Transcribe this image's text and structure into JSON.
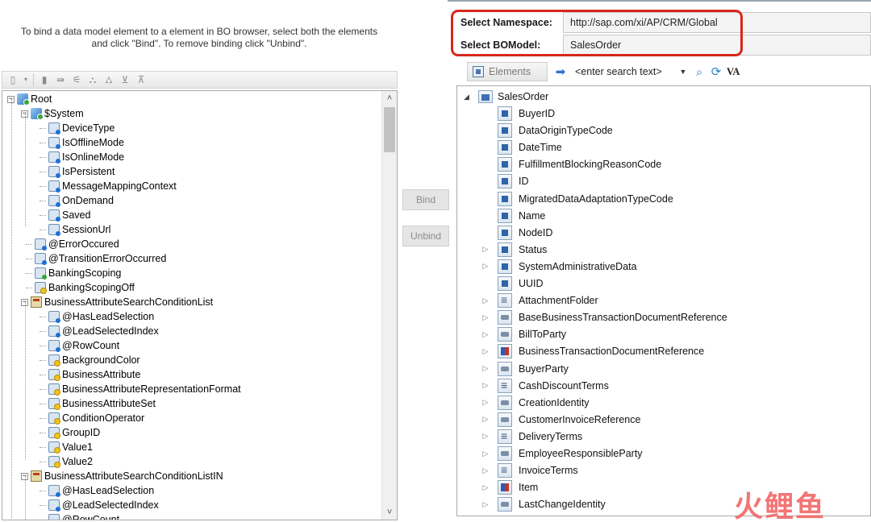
{
  "instructions": "To bind a data model element to a element in BO browser, select both the elements and click \"Bind\". To remove binding click \"Unbind\".",
  "left_toolbar": {
    "icons": [
      "new-document-icon",
      "delete-icon",
      "move-icon",
      "filter-icon",
      "expand-node-icon",
      "collapse-node-icon",
      "expand-all-icon",
      "collapse-all-icon"
    ]
  },
  "left_tree": {
    "items": [
      {
        "label": "Root",
        "level": 0,
        "icon": "root",
        "expander": "−"
      },
      {
        "label": "$System",
        "level": 1,
        "icon": "root",
        "expander": "−"
      },
      {
        "label": "DeviceType",
        "level": 2,
        "icon": "blue"
      },
      {
        "label": "IsOfflineMode",
        "level": 2,
        "icon": "blue"
      },
      {
        "label": "IsOnlineMode",
        "level": 2,
        "icon": "blue"
      },
      {
        "label": "IsPersistent",
        "level": 2,
        "icon": "blue"
      },
      {
        "label": "MessageMappingContext",
        "level": 2,
        "icon": "blue"
      },
      {
        "label": "OnDemand",
        "level": 2,
        "icon": "blue"
      },
      {
        "label": "Saved",
        "level": 2,
        "icon": "blue"
      },
      {
        "label": "SessionUrl",
        "level": 2,
        "icon": "blue"
      },
      {
        "label": "@ErrorOccured",
        "level": 1,
        "icon": "blue"
      },
      {
        "label": "@TransitionErrorOccurred",
        "level": 1,
        "icon": "blue"
      },
      {
        "label": "BankingScoping",
        "level": 1,
        "icon": "green"
      },
      {
        "label": "BankingScopingOff",
        "level": 1,
        "icon": "yellow"
      },
      {
        "label": "BusinessAttributeSearchConditionList",
        "level": 1,
        "icon": "folder",
        "expander": "−"
      },
      {
        "label": "@HasLeadSelection",
        "level": 2,
        "icon": "blue"
      },
      {
        "label": "@LeadSelectedIndex",
        "level": 2,
        "icon": "blue"
      },
      {
        "label": "@RowCount",
        "level": 2,
        "icon": "blue"
      },
      {
        "label": "BackgroundColor",
        "level": 2,
        "icon": "yellow"
      },
      {
        "label": "BusinessAttribute",
        "level": 2,
        "icon": "yellow"
      },
      {
        "label": "BusinessAttributeRepresentationFormat",
        "level": 2,
        "icon": "yellow"
      },
      {
        "label": "BusinessAttributeSet",
        "level": 2,
        "icon": "yellow"
      },
      {
        "label": "ConditionOperator",
        "level": 2,
        "icon": "yellow"
      },
      {
        "label": "GroupID",
        "level": 2,
        "icon": "yellow"
      },
      {
        "label": "Value1",
        "level": 2,
        "icon": "yellow"
      },
      {
        "label": "Value2",
        "level": 2,
        "icon": "yellow"
      },
      {
        "label": "BusinessAttributeSearchConditionListIN",
        "level": 1,
        "icon": "folder",
        "expander": "−"
      },
      {
        "label": "@HasLeadSelection",
        "level": 2,
        "icon": "blue"
      },
      {
        "label": "@LeadSelectedIndex",
        "level": 2,
        "icon": "blue"
      },
      {
        "label": "@RowCount",
        "level": 2,
        "icon": "blue"
      }
    ],
    "scroll_up": "˄",
    "scroll_down": "˅"
  },
  "buttons": {
    "bind": "Bind",
    "unbind": "Unbind"
  },
  "namespace": {
    "namespace_label": "Select Namespace:",
    "namespace_value": "http://sap.com/xi/AP/CRM/Global",
    "bomodel_label": "Select BOModel:",
    "bomodel_value": "SalesOrder",
    "highlight_color": "#d9261c"
  },
  "right_toolbar": {
    "elements_tab": "Elements",
    "search_placeholder": "<enter search text>",
    "va_label": "VA"
  },
  "right_tree": {
    "root": "SalesOrder",
    "root_expander": "◢",
    "items": [
      {
        "label": "BuyerID",
        "icon": "attr",
        "expandable": false
      },
      {
        "label": "DataOriginTypeCode",
        "icon": "attr",
        "expandable": false
      },
      {
        "label": "DateTime",
        "icon": "attr",
        "expandable": false
      },
      {
        "label": "FulfillmentBlockingReasonCode",
        "icon": "attr",
        "expandable": false
      },
      {
        "label": "ID",
        "icon": "attr",
        "expandable": false
      },
      {
        "label": "MigratedDataAdaptationTypeCode",
        "icon": "attr",
        "expandable": false
      },
      {
        "label": "Name",
        "icon": "attr",
        "expandable": false
      },
      {
        "label": "NodeID",
        "icon": "attr",
        "expandable": false
      },
      {
        "label": "Status",
        "icon": "attr",
        "expandable": true
      },
      {
        "label": "SystemAdministrativeData",
        "icon": "attr",
        "expandable": true
      },
      {
        "label": "UUID",
        "icon": "attr",
        "expandable": false
      },
      {
        "label": "AttachmentFolder",
        "icon": "list",
        "expandable": true
      },
      {
        "label": "BaseBusinessTransactionDocumentReference",
        "icon": "node",
        "expandable": true
      },
      {
        "label": "BillToParty",
        "icon": "node",
        "expandable": true
      },
      {
        "label": "BusinessTransactionDocumentReference",
        "icon": "assoc",
        "expandable": true
      },
      {
        "label": "BuyerParty",
        "icon": "node",
        "expandable": true
      },
      {
        "label": "CashDiscountTerms",
        "icon": "list",
        "expandable": true
      },
      {
        "label": "CreationIdentity",
        "icon": "node",
        "expandable": true
      },
      {
        "label": "CustomerInvoiceReference",
        "icon": "node",
        "expandable": true
      },
      {
        "label": "DeliveryTerms",
        "icon": "list",
        "expandable": true
      },
      {
        "label": "EmployeeResponsibleParty",
        "icon": "node",
        "expandable": true
      },
      {
        "label": "InvoiceTerms",
        "icon": "list",
        "expandable": true
      },
      {
        "label": "Item",
        "icon": "assoc",
        "expandable": true
      },
      {
        "label": "LastChangeIdentity",
        "icon": "node",
        "expandable": true
      }
    ]
  },
  "watermark": "火鲤鱼"
}
